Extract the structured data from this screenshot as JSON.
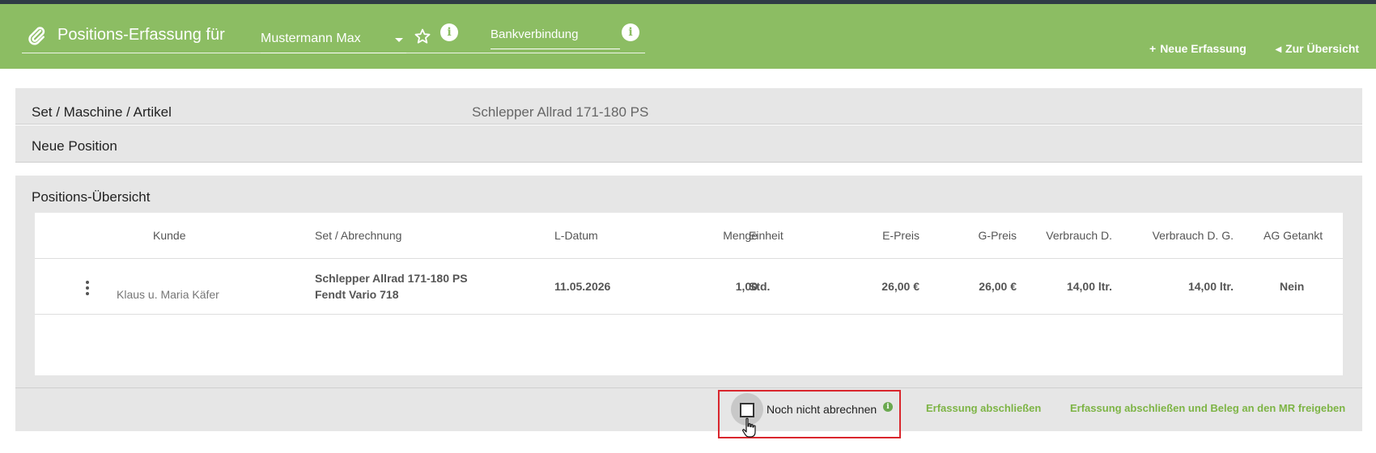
{
  "header": {
    "title": "Positions-Erfassung für",
    "user_select_value": "Mustermann Max",
    "bank_field_label": "Bankverbindung",
    "new_entry_label": "Neue Erfassung",
    "overview_label": "Zur Übersicht"
  },
  "panels": {
    "set_label": "Set / Maschine / Artikel",
    "set_value": "Schlepper Allrad 171-180 PS",
    "new_position_label": "Neue Position",
    "overview_title": "Positions-Übersicht"
  },
  "table": {
    "columns": [
      "Kunde",
      "Set / Abrechnung",
      "L-Datum",
      "Menge",
      "Einheit",
      "E-Preis",
      "G-Preis",
      "Verbrauch D.",
      "Verbrauch D. G.",
      "AG Getankt"
    ],
    "rows": [
      {
        "kunde": "Klaus u. Maria Käfer",
        "set_line1": "Schlepper Allrad 171-180 PS",
        "set_line2": "Fendt Vario 718",
        "l_datum": "11.05.2026",
        "menge": "1,00",
        "einheit": "Std.",
        "e_preis": "26,00 €",
        "g_preis": "26,00 €",
        "verbrauch_d": "14,00 ltr.",
        "verbrauch_dg": "14,00 ltr.",
        "ag_getankt": "Nein"
      }
    ]
  },
  "footer": {
    "checkbox_label": "Noch nicht abrechnen",
    "checkbox_checked": false,
    "close_label": "Erfassung abschließen",
    "close_release_label": "Erfassung abschließen und Beleg an den MR freigeben"
  },
  "colors": {
    "header_bg": "#8cbd63",
    "link_green": "#7db445",
    "highlight_red": "#d9262d",
    "panel_bg": "#e6e6e6"
  },
  "icons": [
    "paperclip-icon",
    "chevron-down-icon",
    "star-icon",
    "info-icon",
    "plus-icon",
    "chevron-left-icon",
    "kebab-menu-icon",
    "checkbox-icon",
    "hand-cursor-icon"
  ]
}
